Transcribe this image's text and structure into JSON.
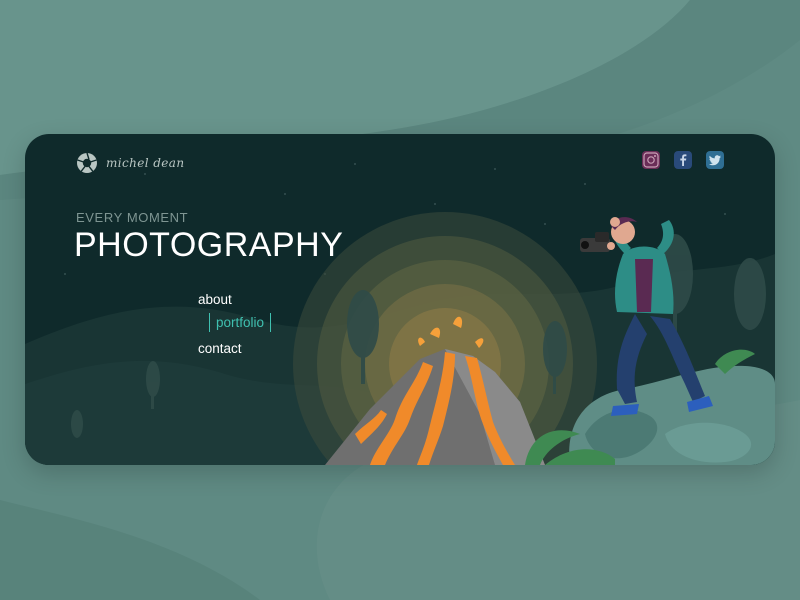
{
  "brand": {
    "name": "michel dean",
    "logo_icon": "camera-shutter-icon"
  },
  "hero": {
    "eyebrow": "EVERY MOMENT",
    "title": "PHOTOGRAPHY"
  },
  "nav": {
    "items": [
      {
        "label": "about",
        "active": false
      },
      {
        "label": "portfolio",
        "active": true
      },
      {
        "label": "contact",
        "active": false
      }
    ]
  },
  "social": [
    {
      "icon": "instagram-icon"
    },
    {
      "icon": "facebook-icon"
    },
    {
      "icon": "twitter-icon"
    }
  ],
  "colors": {
    "page_background": "#5f8a83",
    "card_background": "#0f2a2b",
    "accent": "#3fc0b0",
    "lava": "#f08a2a"
  }
}
